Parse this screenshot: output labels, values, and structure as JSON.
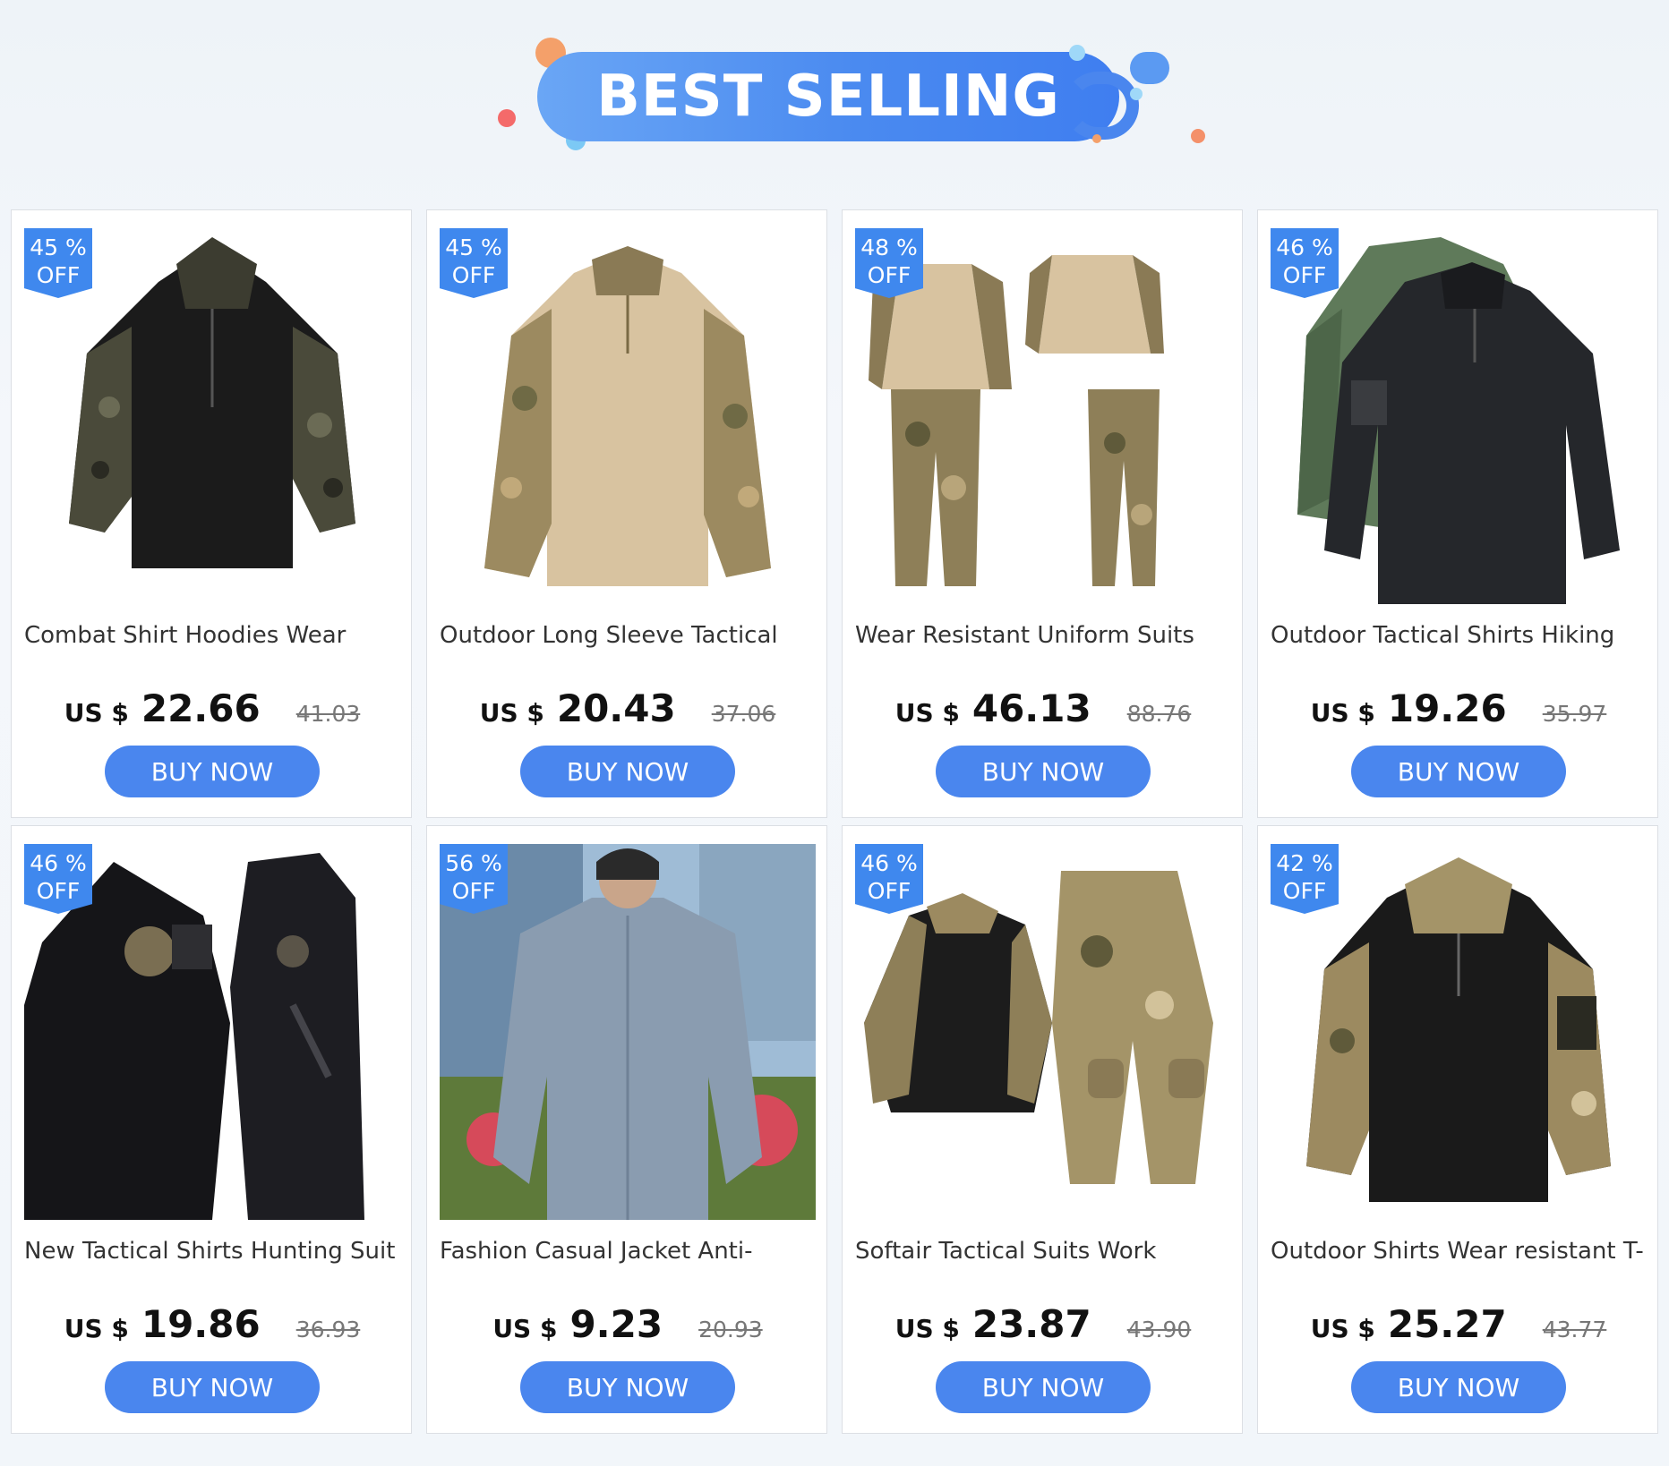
{
  "banner": {
    "title": "BEST SELLING"
  },
  "products": [
    {
      "badge_pct": "45 %",
      "badge_off": "OFF",
      "title": "Combat Shirt Hoodies Wear",
      "currency": "US $",
      "price": "22.66",
      "old_price": "41.03",
      "button": "BUY NOW"
    },
    {
      "badge_pct": "45 %",
      "badge_off": "OFF",
      "title": "Outdoor Long Sleeve Tactical",
      "currency": "US $",
      "price": "20.43",
      "old_price": "37.06",
      "button": "BUY NOW"
    },
    {
      "badge_pct": "48 %",
      "badge_off": "OFF",
      "title": "Wear Resistant Uniform Suits",
      "currency": "US $",
      "price": "46.13",
      "old_price": "88.76",
      "button": "BUY NOW"
    },
    {
      "badge_pct": "46 %",
      "badge_off": "OFF",
      "title": "Outdoor Tactical Shirts Hiking",
      "currency": "US $",
      "price": "19.26",
      "old_price": "35.97",
      "button": "BUY NOW"
    },
    {
      "badge_pct": "46 %",
      "badge_off": "OFF",
      "title": "New Tactical Shirts Hunting Suit",
      "currency": "US $",
      "price": "19.86",
      "old_price": "36.93",
      "button": "BUY NOW"
    },
    {
      "badge_pct": "56 %",
      "badge_off": "OFF",
      "title": "Fashion Casual Jacket Anti-",
      "currency": "US $",
      "price": "9.23",
      "old_price": "20.93",
      "button": "BUY NOW"
    },
    {
      "badge_pct": "46 %",
      "badge_off": "OFF",
      "title": "Softair Tactical Suits Work",
      "currency": "US $",
      "price": "23.87",
      "old_price": "43.90",
      "button": "BUY NOW"
    },
    {
      "badge_pct": "42 %",
      "badge_off": "OFF",
      "title": "Outdoor Shirts Wear resistant T-",
      "currency": "US $",
      "price": "25.27",
      "old_price": "43.77",
      "button": "BUY NOW"
    }
  ],
  "colors": {
    "accent": "#4a86ee",
    "badge": "#3f88ee"
  }
}
